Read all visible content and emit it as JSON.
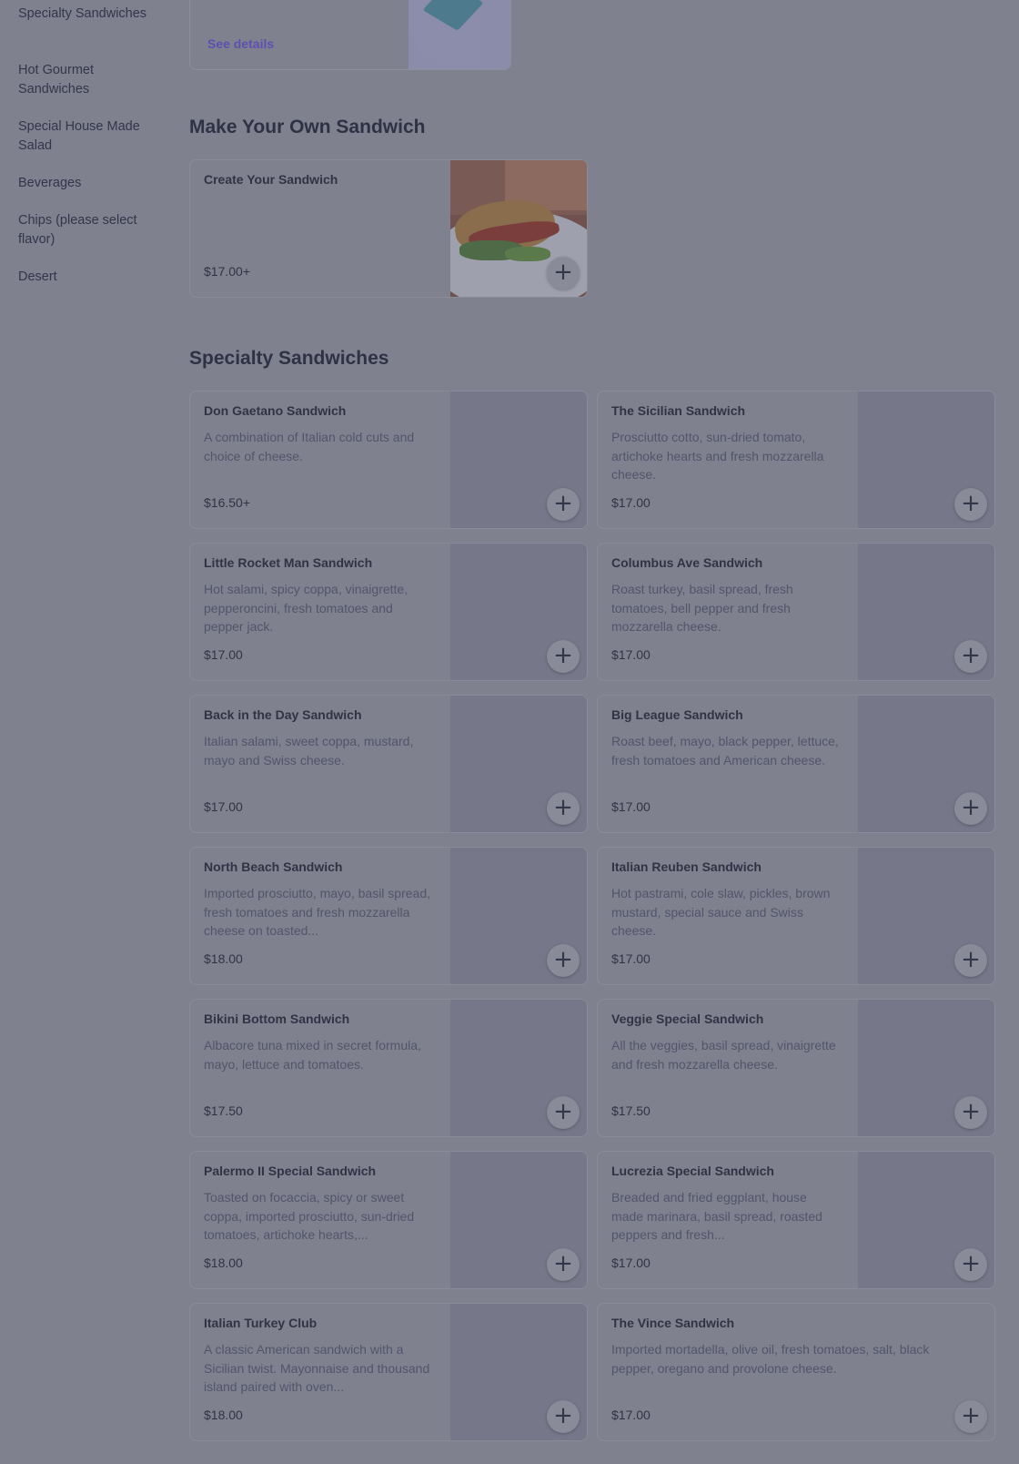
{
  "sidebar": {
    "items": [
      {
        "label": "Specialty Sandwiches"
      },
      {
        "label": "Hot Gourmet Sandwiches"
      },
      {
        "label": "Special House Made Salad"
      },
      {
        "label": "Beverages"
      },
      {
        "label": "Chips (please select flavor)"
      },
      {
        "label": "Desert"
      }
    ]
  },
  "promo": {
    "link_label": "See details"
  },
  "sections": {
    "make_your_own": {
      "title": "Make Your Own Sandwich",
      "items": [
        {
          "name": "Create Your Sandwich",
          "description": "",
          "price": "$17.00+"
        }
      ]
    },
    "specialty": {
      "title": "Specialty Sandwiches",
      "items": [
        {
          "name": "Don Gaetano Sandwich",
          "description": "A combination of Italian cold cuts and choice of cheese.",
          "price": "$16.50+"
        },
        {
          "name": "The Sicilian Sandwich",
          "description": "Prosciutto cotto, sun-dried tomato, artichoke hearts and fresh mozzarella cheese.",
          "price": "$17.00"
        },
        {
          "name": "Little Rocket Man Sandwich",
          "description": "Hot salami, spicy coppa, vinaigrette, pepperoncini, fresh tomatoes and pepper jack.",
          "price": "$17.00"
        },
        {
          "name": "Columbus Ave Sandwich",
          "description": "Roast turkey, basil spread, fresh tomatoes, bell pepper and fresh mozzarella cheese.",
          "price": "$17.00"
        },
        {
          "name": "Back in the Day Sandwich",
          "description": "Italian salami, sweet coppa, mustard, mayo and Swiss cheese.",
          "price": "$17.00"
        },
        {
          "name": "Big League Sandwich",
          "description": "Roast beef, mayo, black pepper, lettuce, fresh tomatoes and American cheese.",
          "price": "$17.00"
        },
        {
          "name": "North Beach Sandwich",
          "description": "Imported prosciutto, mayo, basil spread, fresh tomatoes and fresh mozzarella cheese on toasted...",
          "price": "$18.00"
        },
        {
          "name": "Italian Reuben Sandwich",
          "description": "Hot pastrami, cole slaw, pickles, brown mustard, special sauce and Swiss cheese.",
          "price": "$17.00"
        },
        {
          "name": "Bikini Bottom Sandwich",
          "description": "Albacore tuna mixed in secret formula, mayo, lettuce and tomatoes.",
          "price": "$17.50"
        },
        {
          "name": "Veggie Special Sandwich",
          "description": "All the veggies, basil spread, vinaigrette and fresh mozzarella cheese.",
          "price": "$17.50"
        },
        {
          "name": "Palermo II Special Sandwich",
          "description": "Toasted on focaccia, spicy or sweet coppa, imported prosciutto, sun-dried tomatoes, artichoke hearts,...",
          "price": "$18.00"
        },
        {
          "name": "Lucrezia Special Sandwich",
          "description": "Breaded and fried eggplant, house made marinara, basil spread, roasted peppers and fresh...",
          "price": "$17.00"
        },
        {
          "name": "Italian Turkey Club",
          "description": "A classic American sandwich with a Sicilian twist. Mayonnaise and thousand island paired with oven...",
          "price": "$18.00"
        },
        {
          "name": "The Vince Sandwich",
          "description": "Imported mortadella, olive oil, fresh tomatoes, salt, black pepper, oregano and provolone cheese.",
          "price": "$17.00"
        }
      ]
    }
  },
  "icons": {
    "add": "+"
  }
}
